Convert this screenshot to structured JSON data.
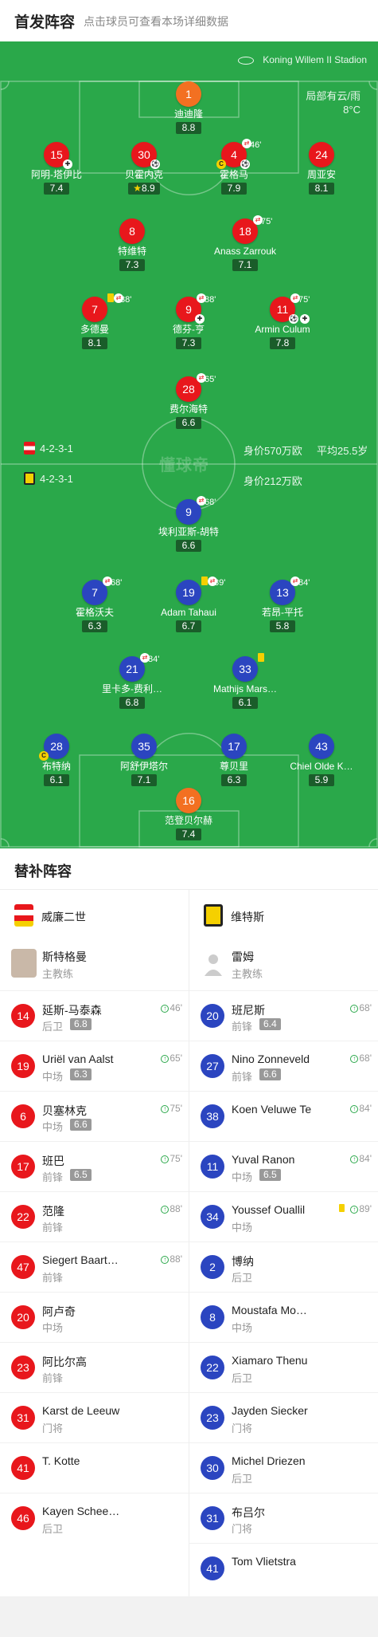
{
  "header": {
    "title": "首发阵容",
    "subtitle": "点击球员可查看本场详细数据"
  },
  "pitch": {
    "stadium": "Koning Willem II Stadion",
    "weather_line1": "局部有云/雨",
    "weather_line2": "8°C",
    "watermark": "懂球帝",
    "home": {
      "formation": "4-2-3-1",
      "value": "身价570万欧",
      "age": "平均25.5岁"
    },
    "away": {
      "formation": "4-2-3-1",
      "value": "身价212万欧"
    }
  },
  "home_lineup": [
    {
      "num": "1",
      "name": "迪迪隆",
      "rating": "8.8"
    },
    {
      "num": "15",
      "name": "阿明-塔伊比",
      "rating": "7.4"
    },
    {
      "num": "30",
      "name": "贝霍内克",
      "rating": "8.9"
    },
    {
      "num": "4",
      "name": "霍格马",
      "rating": "7.9",
      "sub": "46'"
    },
    {
      "num": "24",
      "name": "周亚安",
      "rating": "8.1"
    },
    {
      "num": "8",
      "name": "特维特",
      "rating": "7.3"
    },
    {
      "num": "18",
      "name": "Anass Zarrouk",
      "rating": "7.1",
      "sub": "75'"
    },
    {
      "num": "7",
      "name": "多德曼",
      "rating": "8.1",
      "sub": "88'"
    },
    {
      "num": "9",
      "name": "德芬-亨",
      "rating": "7.3",
      "sub": "88'"
    },
    {
      "num": "11",
      "name": "Armin Culum",
      "rating": "7.8",
      "sub": "75'"
    },
    {
      "num": "28",
      "name": "费尔海特",
      "rating": "6.6",
      "sub": "65'"
    }
  ],
  "away_lineup": [
    {
      "num": "9",
      "name": "埃利亚斯-胡特",
      "rating": "6.6",
      "sub": "68'"
    },
    {
      "num": "7",
      "name": "霍格沃夫",
      "rating": "6.3",
      "sub": "68'"
    },
    {
      "num": "19",
      "name": "Adam Tahaui",
      "rating": "6.7",
      "sub": "89'"
    },
    {
      "num": "13",
      "name": "若昂-平托",
      "rating": "5.8",
      "sub": "84'"
    },
    {
      "num": "21",
      "name": "里卡多-费利…",
      "rating": "6.8",
      "sub": "84'"
    },
    {
      "num": "33",
      "name": "Mathijs Mars…",
      "rating": "6.1"
    },
    {
      "num": "28",
      "name": "布特纳",
      "rating": "6.1"
    },
    {
      "num": "35",
      "name": "阿舒伊塔尔",
      "rating": "7.1"
    },
    {
      "num": "17",
      "name": "尊贝里",
      "rating": "6.3"
    },
    {
      "num": "43",
      "name": "Chiel Olde K…",
      "rating": "5.9"
    },
    {
      "num": "16",
      "name": "范登贝尔赫",
      "rating": "7.4"
    }
  ],
  "subs_title": "替补阵容",
  "home_team": {
    "name": "威廉二世",
    "coach": "斯特格曼",
    "coach_role": "主教练"
  },
  "away_team": {
    "name": "维特斯",
    "coach": "雷姆",
    "coach_role": "主教练"
  },
  "home_subs": [
    {
      "num": "14",
      "name": "延斯-马泰森",
      "pos": "后卫",
      "rating": "6.8",
      "in": "46'"
    },
    {
      "num": "19",
      "name": "Uriël van Aalst",
      "pos": "中场",
      "rating": "6.3",
      "in": "65'"
    },
    {
      "num": "6",
      "name": "贝塞林克",
      "pos": "中场",
      "rating": "6.6",
      "in": "75'"
    },
    {
      "num": "17",
      "name": "班巴",
      "pos": "前锋",
      "rating": "6.5",
      "in": "75'"
    },
    {
      "num": "22",
      "name": "范隆",
      "pos": "前锋",
      "in": "88'"
    },
    {
      "num": "47",
      "name": "Siegert Baart…",
      "pos": "前锋",
      "in": "88'"
    },
    {
      "num": "20",
      "name": "阿卢奇",
      "pos": "中场"
    },
    {
      "num": "23",
      "name": "阿比尔高",
      "pos": "前锋"
    },
    {
      "num": "31",
      "name": "Karst de Leeuw",
      "pos": "门将"
    },
    {
      "num": "41",
      "name": "T. Kotte",
      "pos": ""
    },
    {
      "num": "46",
      "name": "Kayen Schee…",
      "pos": "后卫"
    }
  ],
  "away_subs": [
    {
      "num": "20",
      "name": "班尼斯",
      "pos": "前锋",
      "rating": "6.4",
      "in": "68'"
    },
    {
      "num": "27",
      "name": "Nino Zonneveld",
      "pos": "前锋",
      "rating": "6.6",
      "in": "68'"
    },
    {
      "num": "38",
      "name": "Koen Veluwe Te",
      "pos": "",
      "in": "84'"
    },
    {
      "num": "11",
      "name": "Yuval Ranon",
      "pos": "中场",
      "rating": "6.5",
      "in": "84'"
    },
    {
      "num": "34",
      "name": "Youssef Ouallil",
      "pos": "中场",
      "in": "89'"
    },
    {
      "num": "2",
      "name": "博纳",
      "pos": "后卫"
    },
    {
      "num": "8",
      "name": "Moustafa Mo…",
      "pos": "中场"
    },
    {
      "num": "22",
      "name": "Xiamaro Thenu",
      "pos": "后卫"
    },
    {
      "num": "23",
      "name": "Jayden Siecker",
      "pos": "门将"
    },
    {
      "num": "30",
      "name": "Michel Driezen",
      "pos": "后卫"
    },
    {
      "num": "31",
      "name": "布吕尔",
      "pos": "门将"
    },
    {
      "num": "41",
      "name": "Tom Vlietstra",
      "pos": ""
    }
  ],
  "colors": {
    "home": "#e8171c",
    "away": "#2b45c0",
    "keeper": "#f37021",
    "pitch": "#2aa84a"
  }
}
